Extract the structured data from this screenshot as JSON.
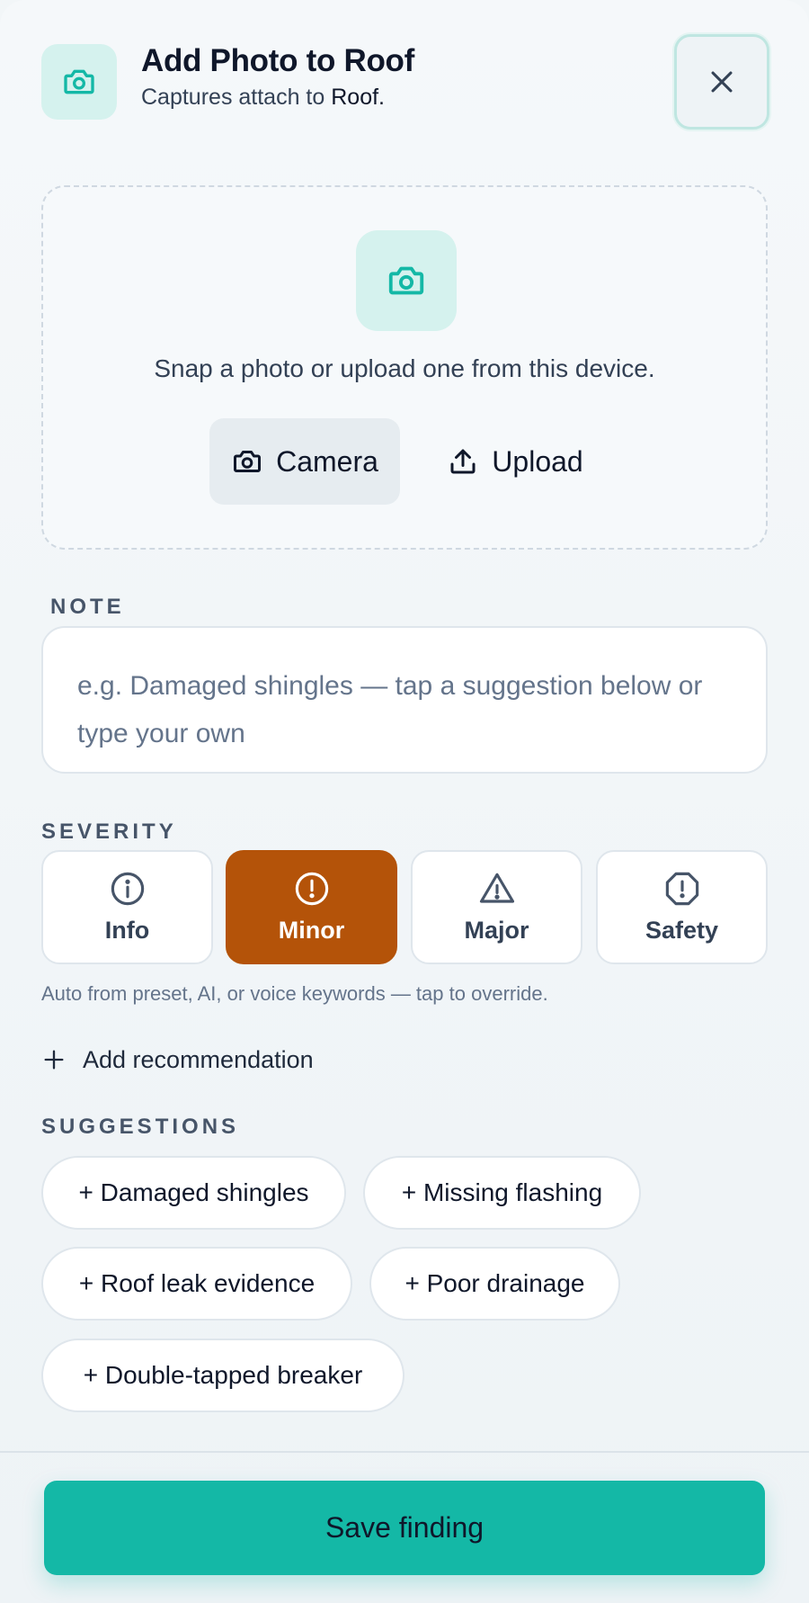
{
  "header": {
    "title": "Add Photo to Roof",
    "subtitle_prefix": "Captures attach to",
    "subtitle_target": "Roof."
  },
  "capture": {
    "prompt": "Snap a photo or upload one from this device.",
    "camera_label": "Camera",
    "upload_label": "Upload"
  },
  "note": {
    "label": "NOTE",
    "placeholder": "e.g. Damaged shingles — tap a suggestion below or type your own"
  },
  "severity": {
    "label": "SEVERITY",
    "options": [
      {
        "label": "Info",
        "icon": "info-circle-icon"
      },
      {
        "label": "Minor",
        "icon": "alert-circle-icon"
      },
      {
        "label": "Major",
        "icon": "warning-triangle-icon"
      },
      {
        "label": "Safety",
        "icon": "alert-octagon-icon"
      }
    ],
    "selected": "Minor",
    "hint": "Auto from preset, AI, or voice keywords — tap to override."
  },
  "recommendation": {
    "add_label": "Add recommendation"
  },
  "suggestions": {
    "label": "SUGGESTIONS",
    "items": [
      "+ Damaged shingles",
      "+ Missing flashing",
      "+ Roof leak evidence",
      "+ Poor drainage",
      "+ Double-tapped breaker"
    ]
  },
  "footer": {
    "save_label": "Save finding"
  },
  "colors": {
    "accent": "#14b8a6",
    "accent_soft": "#d5f2ee",
    "selected_severity": "#b45309"
  }
}
